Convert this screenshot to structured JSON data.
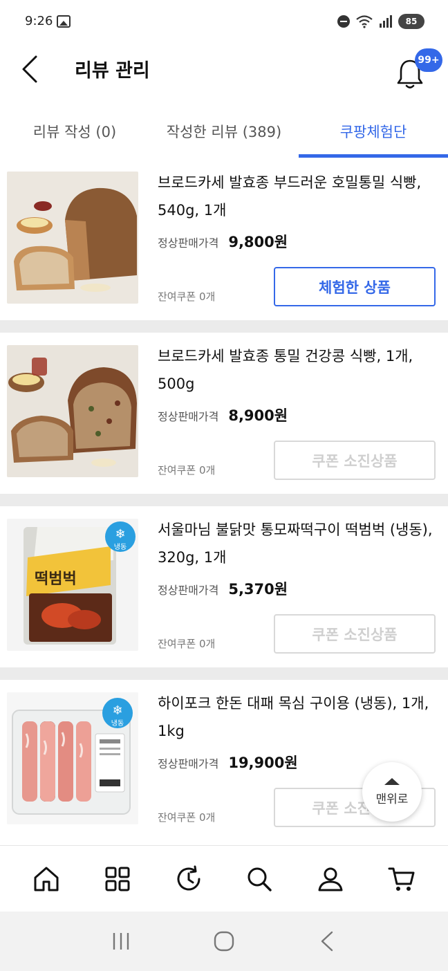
{
  "status_bar": {
    "time": "9:26",
    "battery": "85"
  },
  "header": {
    "title": "리뷰 관리",
    "notification_badge": "99+"
  },
  "tabs": [
    {
      "label": "리뷰 작성 (0)",
      "active": false
    },
    {
      "label": "작성한 리뷰 (389)",
      "active": false
    },
    {
      "label": "쿠팡체험단",
      "active": true
    }
  ],
  "products": [
    {
      "name": "브로드카세 발효종 부드러운 호밀통밀 식빵, 540g, 1개",
      "price_label": "정상판매가격",
      "price": "9,800원",
      "coupon": "잔여쿠폰 0개",
      "button_label": "체험한 상품",
      "button_state": "primary",
      "image": "bread-loaf-image"
    },
    {
      "name": "브로드카세 발효종 통밀 건강콩 식빵, 1개, 500g",
      "price_label": "정상판매가격",
      "price": "8,900원",
      "coupon": "잔여쿠폰 0개",
      "button_label": "쿠폰 소진상품",
      "button_state": "disabled",
      "image": "bean-bread-image"
    },
    {
      "name": "서울마님 불닭맛 통모짜떡구이 떡범벅 (냉동), 320g, 1개",
      "price_label": "정상판매가격",
      "price": "5,370원",
      "coupon": "잔여쿠폰 0개",
      "button_label": "쿠폰 소진상품",
      "button_state": "disabled",
      "image": "tteok-package-image",
      "package_text": "떡범벅",
      "frozen_badge": "냉동"
    },
    {
      "name": "하이포크 한돈 대패 목심 구이용 (냉동), 1개, 1kg",
      "price_label": "정상판매가격",
      "price": "19,900원",
      "coupon": "잔여쿠폰 0개",
      "button_label": "쿠폰 소진상품",
      "button_state": "disabled",
      "image": "pork-tray-image",
      "frozen_badge": "냉동"
    }
  ],
  "scroll_top": {
    "label": "맨위로"
  },
  "bottom_nav": [
    "home-icon",
    "category-grid-icon",
    "recent-history-icon",
    "search-icon",
    "user-icon",
    "cart-icon"
  ],
  "colors": {
    "accent": "#3468e8",
    "disabled": "#cfcfcf",
    "separator": "#ebebeb"
  }
}
